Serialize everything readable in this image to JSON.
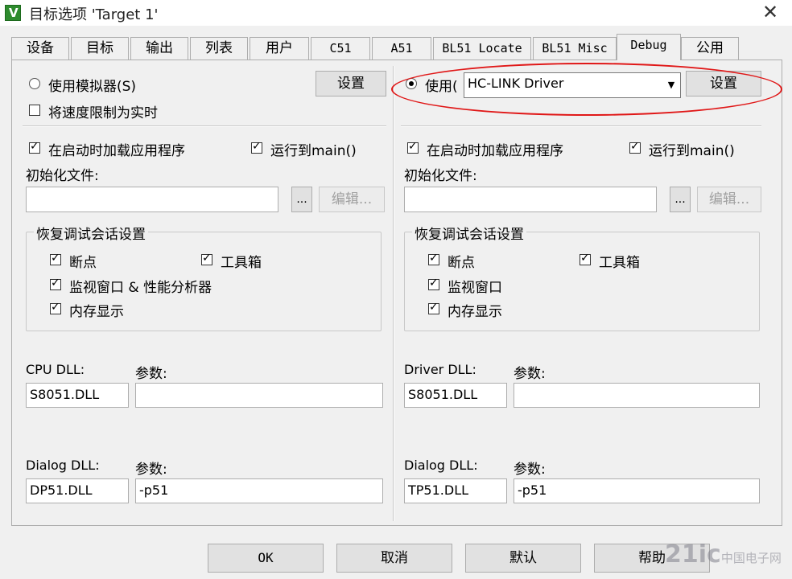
{
  "window": {
    "title": "目标选项 'Target 1'"
  },
  "tabs": [
    {
      "label": "设备"
    },
    {
      "label": "目标"
    },
    {
      "label": "输出"
    },
    {
      "label": "列表"
    },
    {
      "label": "用户"
    },
    {
      "label": "C51"
    },
    {
      "label": "A51"
    },
    {
      "label": "BL51 Locate"
    },
    {
      "label": "BL51 Misc"
    },
    {
      "label": "Debug"
    },
    {
      "label": "公用"
    }
  ],
  "left": {
    "use_simulator": "使用模拟器(S)",
    "limit_speed": "将速度限制为实时",
    "settings": "设置",
    "load_app": "在启动时加载应用程序",
    "run_to_main": "运行到main()",
    "init_file_label": "初始化文件:",
    "init_file_value": "",
    "browse": "...",
    "edit": "编辑...",
    "restore_group": "恢复调试会话设置",
    "breakpoints": "断点",
    "toolbox": "工具箱",
    "watch_windows": "监视窗口 & 性能分析器",
    "memory_display": "内存显示",
    "cpu_dll_label": "CPU DLL:",
    "cpu_dll_value": "S8051.DLL",
    "param_label": "参数:",
    "cpu_param_value": "",
    "dialog_dll_label": "Dialog DLL:",
    "dialog_dll_value": "DP51.DLL",
    "dialog_param_value": "-p51"
  },
  "right": {
    "use": "使用(",
    "driver_selected": "HC-LINK Driver",
    "settings": "设置",
    "load_app": "在启动时加载应用程序",
    "run_to_main": "运行到main()",
    "init_file_label": "初始化文件:",
    "init_file_value": "",
    "browse": "...",
    "edit": "编辑...",
    "restore_group": "恢复调试会话设置",
    "breakpoints": "断点",
    "toolbox": "工具箱",
    "watch_windows": "监视窗口",
    "memory_display": "内存显示",
    "driver_dll_label": "Driver DLL:",
    "driver_dll_value": "S8051.DLL",
    "param_label": "参数:",
    "driver_param_value": "",
    "dialog_dll_label": "Dialog DLL:",
    "dialog_dll_value": "TP51.DLL",
    "dialog_param_value": "-p51"
  },
  "footer": {
    "ok": "OK",
    "cancel": "取消",
    "defaults": "默认",
    "help": "帮助"
  },
  "watermark": {
    "main": "21ic",
    "sub": "中国电子网"
  },
  "colors": {
    "annotation": "#e01818"
  },
  "icons": {
    "app": "keil-uvision-icon",
    "close": "close-icon",
    "dropdown": "chevron-down-icon"
  }
}
